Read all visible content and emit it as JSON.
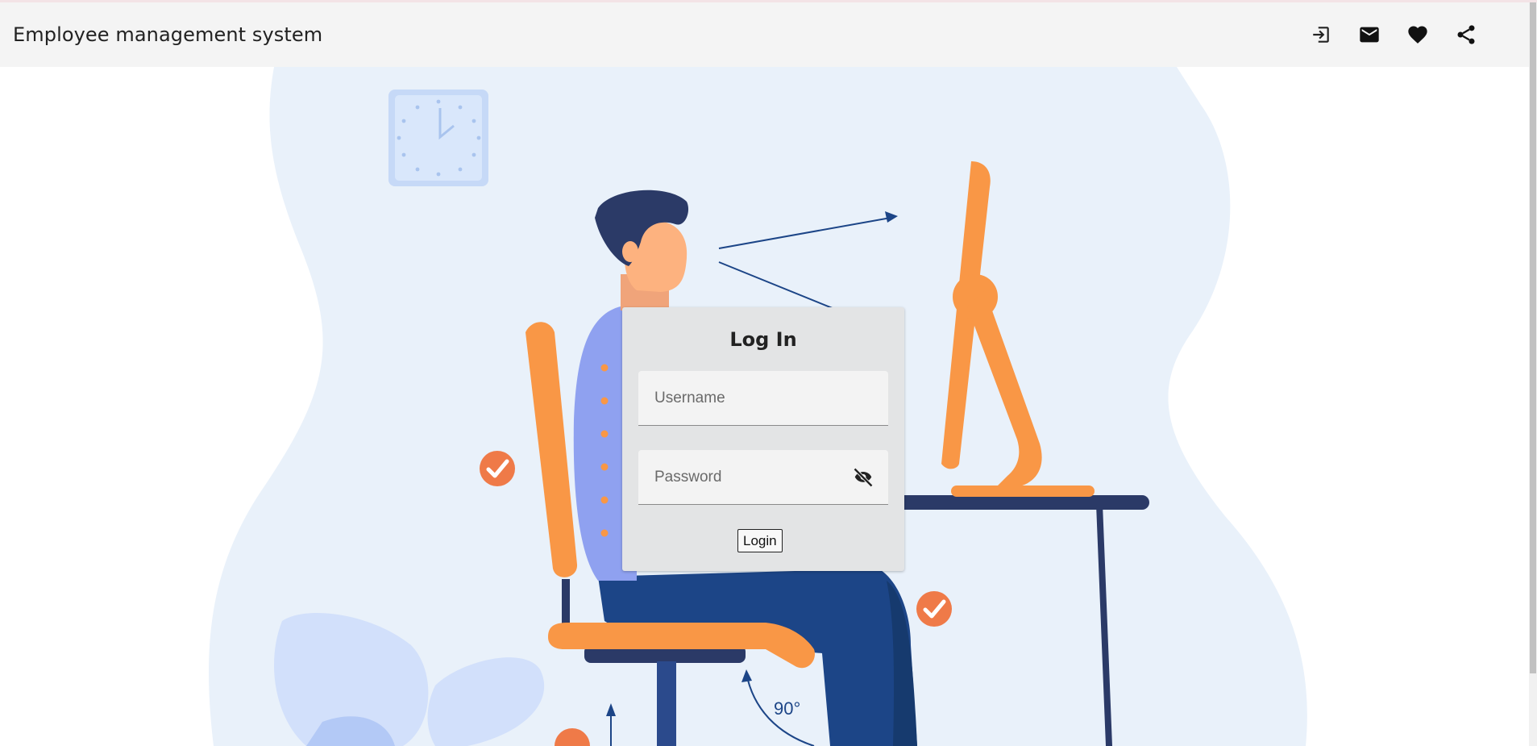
{
  "app": {
    "title": "Employee management system"
  },
  "toolbar": {
    "icons": [
      "login-icon",
      "mail-icon",
      "heart-icon",
      "share-icon"
    ]
  },
  "illustration": {
    "angle_label": "90°"
  },
  "login": {
    "title": "Log In",
    "username_placeholder": "Username",
    "username_value": "",
    "password_placeholder": "Password",
    "password_value": "",
    "button_label": "Login"
  },
  "colors": {
    "appbar": "#f4f4f4",
    "card": "#e3e4e5",
    "accent_orange": "#f99746",
    "check_orange": "#ef7a48",
    "navy": "#1c4587",
    "background_blob": "#e9f1fa"
  }
}
